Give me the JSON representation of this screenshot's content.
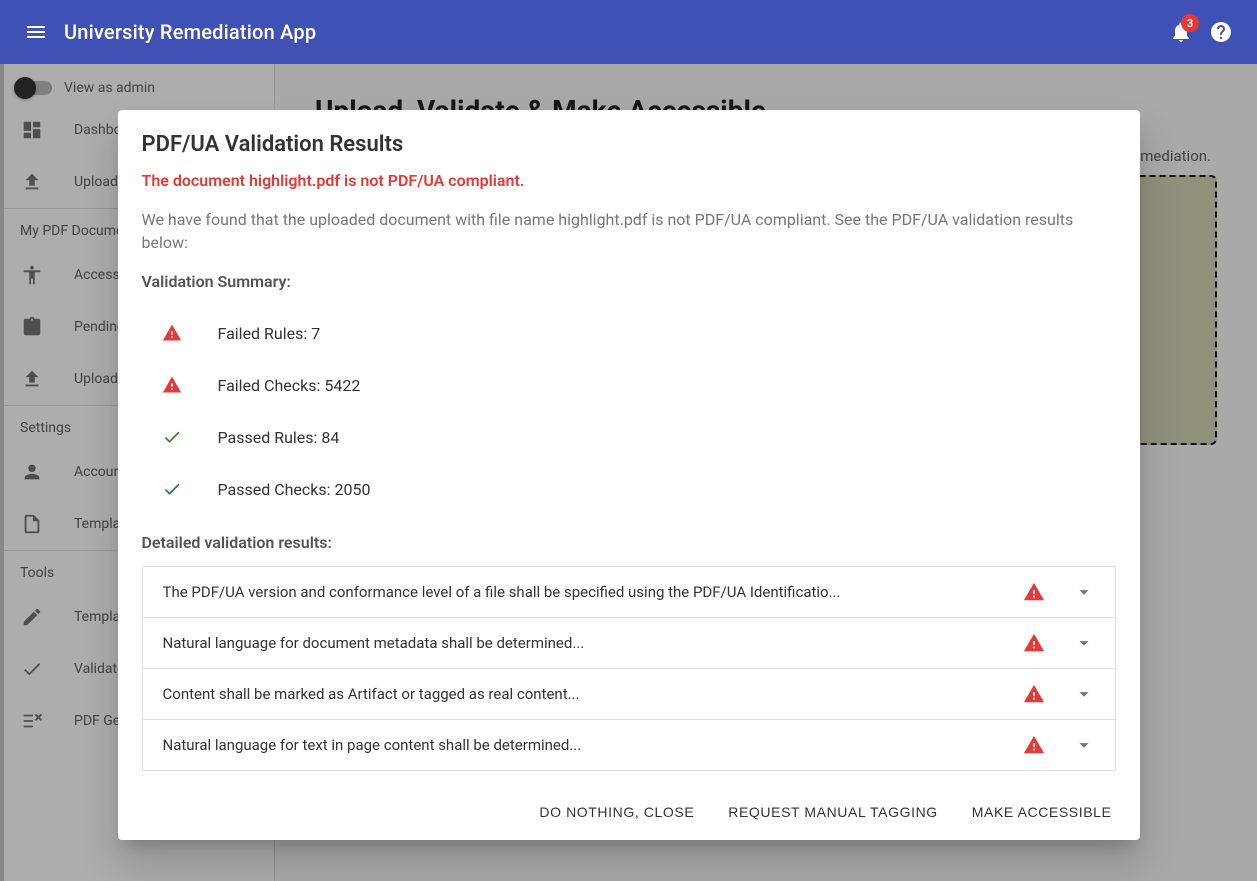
{
  "header": {
    "title": "University Remediation App",
    "notification_count": "3"
  },
  "sidebar": {
    "view_as_label": "View as admin",
    "items_top": [
      {
        "label": "Dashboard"
      },
      {
        "label": "Upload"
      }
    ],
    "group_docs": "My PDF Documents",
    "items_docs": [
      {
        "label": "Accessible"
      },
      {
        "label": "Pending"
      },
      {
        "label": "Uploaded"
      }
    ],
    "group_settings": "Settings",
    "items_settings": [
      {
        "label": "Account"
      },
      {
        "label": "Templates"
      }
    ],
    "group_tools": "Tools",
    "items_tools": [
      {
        "label": "Template Editor"
      },
      {
        "label": "Validator"
      },
      {
        "label": "PDF Generator"
      }
    ]
  },
  "main": {
    "title": "Upload, Validate & Make Accessible",
    "desc_tail": "remediation."
  },
  "dialog": {
    "title": "PDF/UA Validation Results",
    "compliance": "The document highlight.pdf is not PDF/UA compliant.",
    "intro": "We have found that the uploaded document with file name highlight.pdf is not PDF/UA compliant. See the PDF/UA validation results below:",
    "summary_h": "Validation Summary:",
    "summary": [
      {
        "status": "fail",
        "label": "Failed Rules: 7"
      },
      {
        "status": "fail",
        "label": "Failed Checks: 5422"
      },
      {
        "status": "pass",
        "label": "Passed Rules: 84"
      },
      {
        "status": "pass",
        "label": "Passed Checks: 2050"
      }
    ],
    "detailed_h": "Detailed validation results:",
    "detailed": [
      {
        "text": "The PDF/UA version and conformance level of a file shall be specified using the PDF/UA Identificatio..."
      },
      {
        "text": "Natural language for document metadata shall be determined..."
      },
      {
        "text": "Content shall be marked as Artifact or tagged as real content..."
      },
      {
        "text": "Natural language for text in page content shall be determined..."
      }
    ],
    "buttons": {
      "close": "Do nothing, close",
      "request": "Request Manual Tagging",
      "make": "Make Accessible"
    }
  }
}
